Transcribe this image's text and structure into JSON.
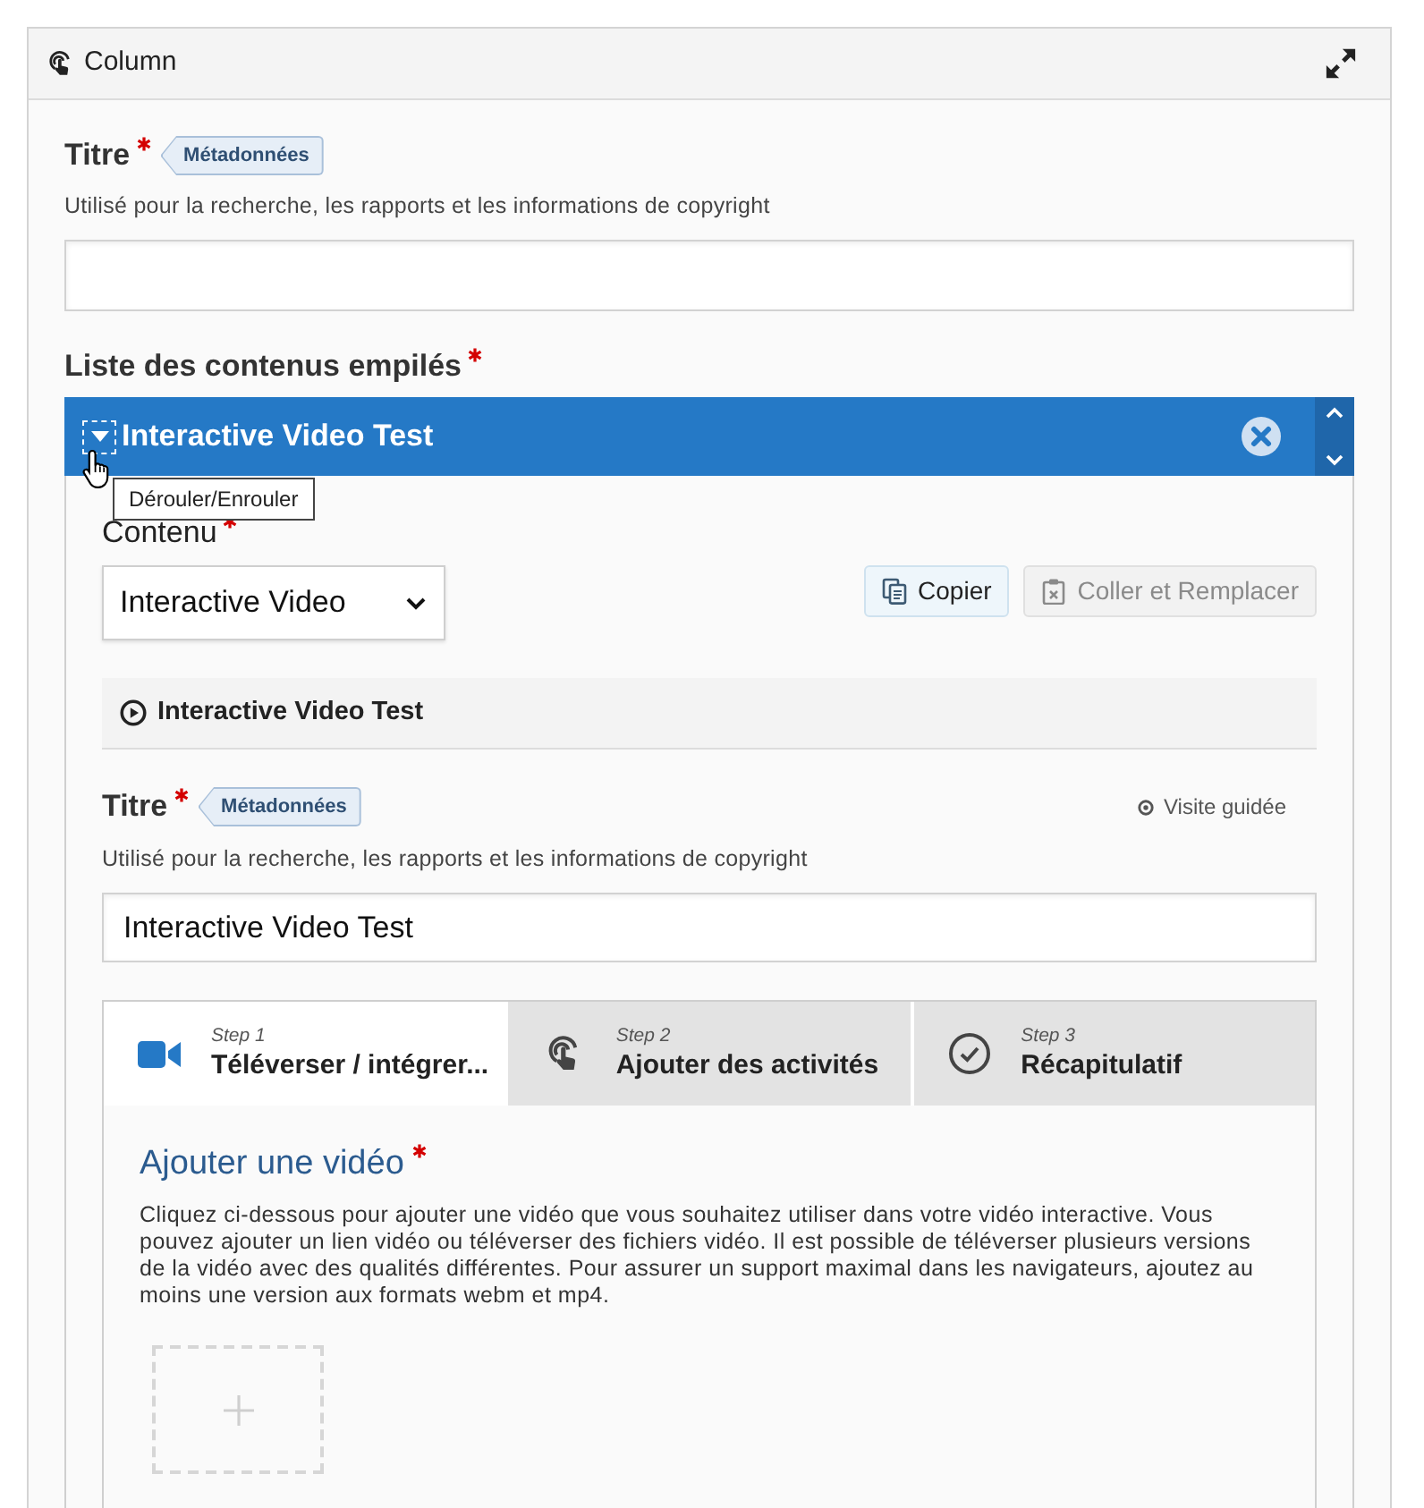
{
  "panel": {
    "title": "Column"
  },
  "title_field": {
    "label": "Titre",
    "required": true,
    "badge": "Métadonnées",
    "description": "Utilisé pour la recherche, les rapports et les informations de copyright"
  },
  "list": {
    "label": "Liste des contenus empilés",
    "required": true,
    "items": [
      {
        "title": "Interactive Video Test",
        "expanded": true,
        "tooltip": "Dérouler/Enrouler",
        "content": {
          "label": "Contenu",
          "required": true,
          "value": "Interactive Video"
        },
        "buttons": [
          {
            "label": "Copier",
            "disabled": false
          },
          {
            "label": "Coller et Remplacer",
            "disabled": true
          }
        ],
        "editor": {
          "header": "Interactive Video Test",
          "title_field": {
            "label": "Titre",
            "required": true,
            "badge": "Métadonnées",
            "description": "Utilisé pour la recherche, les rapports et les informations de copyright",
            "value": "Interactive Video Test"
          },
          "tour_link": "Visite guidée",
          "steps": [
            {
              "kind": "video",
              "step": "Step 1",
              "label": "Téléverser / intégrer...",
              "selected": true
            },
            {
              "kind": "touch",
              "step": "Step 2",
              "label": "Ajouter des activités",
              "selected": false
            },
            {
              "kind": "check",
              "step": "Step 3",
              "label": "Récapitulatif",
              "selected": false
            }
          ],
          "upload": {
            "heading": "Ajouter une vidéo",
            "required": true,
            "description": "Cliquez ci-dessous pour ajouter une vidéo que vous souhaitez utiliser dans votre vidéo interactive. Vous pouvez ajouter un lien vidéo ou téléverser des fichiers vidéo. Il est possible de téléverser plusieurs versions de la vidéo avec des qualités différentes. Pour assurer un support maximal dans les navigateurs, ajoutez au moins une version aux formats webm et mp4."
          }
        }
      }
    ]
  }
}
